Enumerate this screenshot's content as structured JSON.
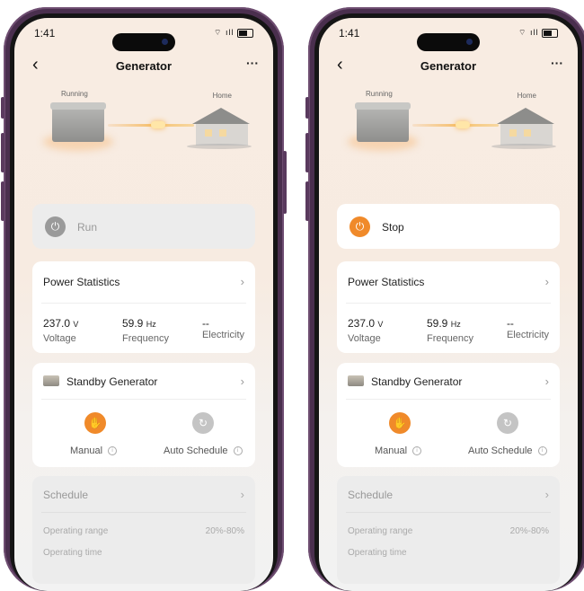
{
  "colors": {
    "accent": "#f08a2a",
    "grey_icon": "#9a9a9a",
    "frame": "#4a2f4e"
  },
  "phones": [
    {
      "status_time": "1:41",
      "status_icons": "⌔ ıll",
      "nav": {
        "back": "‹",
        "title": "Generator",
        "more": "···"
      },
      "scene": {
        "running_label": "Running",
        "home_label": "Home"
      },
      "power": {
        "label": "Run",
        "state": "off"
      },
      "power_statistics": {
        "title": "Power Statistics",
        "chevron": "›",
        "voltage": {
          "value": "237.0",
          "unit": "V",
          "label": "Voltage"
        },
        "frequency": {
          "value": "59.9",
          "unit": "Hz",
          "label": "Frequency"
        },
        "electricity": {
          "value": "--",
          "label": "Electricity"
        }
      },
      "standby": {
        "title": "Standby Generator",
        "chevron": "›",
        "manual": {
          "label": "Manual",
          "active": true
        },
        "auto": {
          "label": "Auto Schedule",
          "active": false
        }
      },
      "schedule": {
        "title": "Schedule",
        "chevron": "›",
        "operating_range": {
          "label": "Operating range",
          "value": "20%-80%"
        },
        "operating_time": {
          "label": "Operating time"
        }
      }
    },
    {
      "status_time": "1:41",
      "status_icons": "⌔ ıll",
      "nav": {
        "back": "‹",
        "title": "Generator",
        "more": "···"
      },
      "scene": {
        "running_label": "Running",
        "home_label": "Home"
      },
      "power": {
        "label": "Stop",
        "state": "on"
      },
      "power_statistics": {
        "title": "Power Statistics",
        "chevron": "›",
        "voltage": {
          "value": "237.0",
          "unit": "V",
          "label": "Voltage"
        },
        "frequency": {
          "value": "59.9",
          "unit": "Hz",
          "label": "Frequency"
        },
        "electricity": {
          "value": "--",
          "label": "Electricity"
        }
      },
      "standby": {
        "title": "Standby Generator",
        "chevron": "›",
        "manual": {
          "label": "Manual",
          "active": true
        },
        "auto": {
          "label": "Auto Schedule",
          "active": false
        }
      },
      "schedule": {
        "title": "Schedule",
        "chevron": "›",
        "operating_range": {
          "label": "Operating range",
          "value": "20%-80%"
        },
        "operating_time": {
          "label": "Operating time"
        }
      }
    }
  ]
}
